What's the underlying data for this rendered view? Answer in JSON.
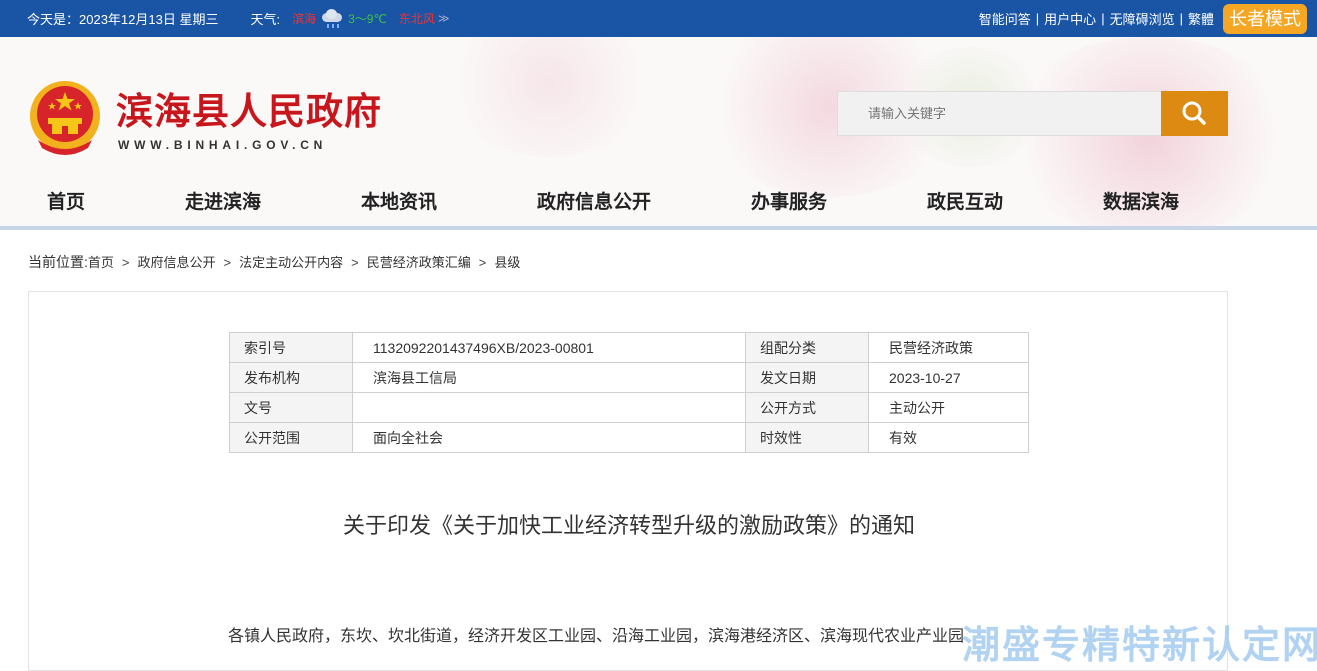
{
  "topbar": {
    "date_text": "今天是：2023年12月13日 星期三",
    "weather_label": "天气:",
    "weather_city": "滨海",
    "weather_temp": "3～9℃",
    "weather_wind": "东北风",
    "weather_more": "≫",
    "links": [
      "智能问答",
      "用户中心",
      "无障碍浏览",
      "繁體"
    ],
    "separator": "|",
    "elder_mode": "长者模式"
  },
  "header": {
    "site_title": "滨海县人民政府",
    "site_url": "WWW.BINHAI.GOV.CN",
    "search_placeholder": "请输入关键字"
  },
  "nav": [
    "首页",
    "走进滨海",
    "本地资讯",
    "政府信息公开",
    "办事服务",
    "政民互动",
    "数据滨海"
  ],
  "breadcrumb": {
    "label": "当前位置:",
    "items": [
      "首页",
      "政府信息公开",
      "法定主动公开内容",
      "民营经济政策汇编",
      "县级"
    ],
    "arrow": ">"
  },
  "meta_table": [
    [
      "索引号",
      "113209220143749​6XB/2023-00801",
      "组配分类",
      "民营经济政策"
    ],
    [
      "发布机构",
      "滨海县工信局",
      "发文日期",
      "2023-10-27"
    ],
    [
      "文号",
      "",
      "公开方式",
      "主动公开"
    ],
    [
      "公开范围",
      "面向全社会",
      "时效性",
      "有效"
    ]
  ],
  "document": {
    "title": "关于印发《关于加快工业经济转型升级的激励政策》的通知",
    "body_line1": "各镇人民政府，东坎、坎北街道，经济开发区工业园、沿海工业园，滨海港经济区、滨海现代农业产业园"
  },
  "watermark": "潮盛专精特新认定网",
  "colors": {
    "topbar_bg": "#1a55a5",
    "title_red": "#c8161d",
    "search_btn": "#dd8a13",
    "elder_btn": "#f5a623"
  }
}
